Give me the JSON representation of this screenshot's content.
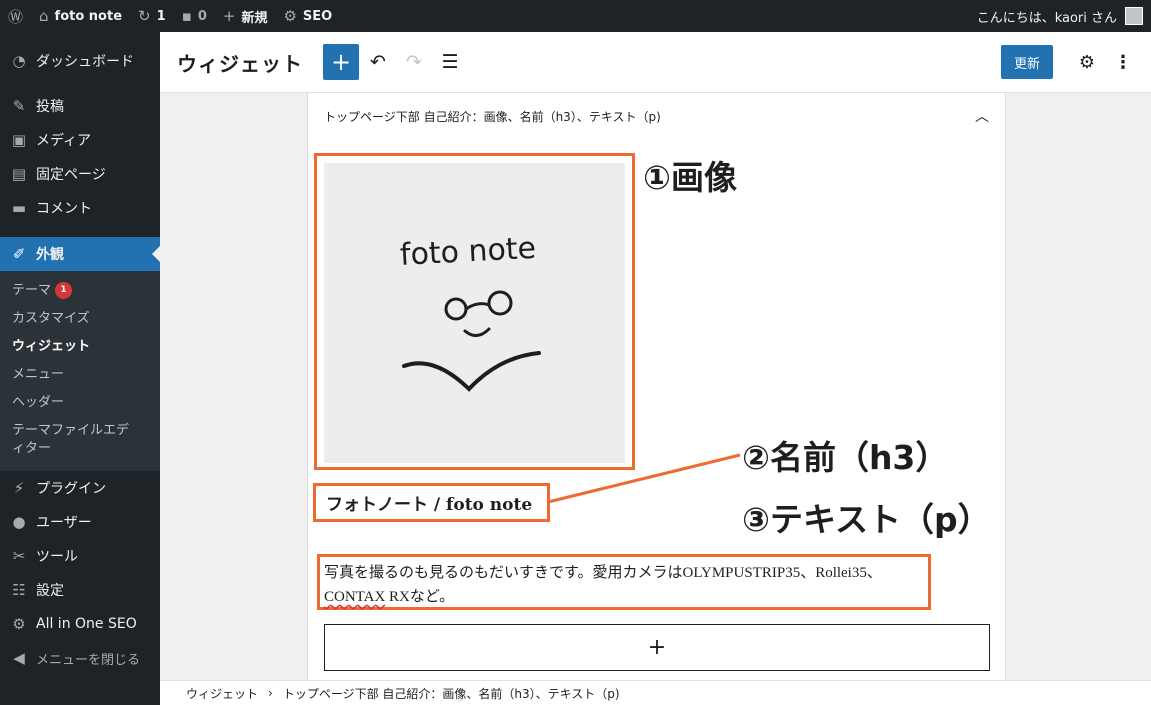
{
  "adminbar": {
    "site_name": "foto note",
    "updates_count": "1",
    "comments_count": "0",
    "new_label": "新規",
    "seo_label": "SEO",
    "greeting": "こんにちは、kaori さん"
  },
  "sidebar": {
    "items": [
      {
        "label": "ダッシュボード",
        "icon": "dashboard-icon"
      },
      {
        "label": "投稿",
        "icon": "pin-icon"
      },
      {
        "label": "メディア",
        "icon": "media-icon"
      },
      {
        "label": "固定ページ",
        "icon": "page-icon"
      },
      {
        "label": "コメント",
        "icon": "comment-icon"
      },
      {
        "label": "外観",
        "icon": "brush-icon"
      },
      {
        "label": "プラグイン",
        "icon": "plugin-icon"
      },
      {
        "label": "ユーザー",
        "icon": "user-icon"
      },
      {
        "label": "ツール",
        "icon": "wrench-icon"
      },
      {
        "label": "設定",
        "icon": "settings-icon"
      },
      {
        "label": "All in One SEO",
        "icon": "seo-icon"
      },
      {
        "label": "メニューを閉じる",
        "icon": "collapse-icon"
      }
    ],
    "submenu": [
      {
        "label": "テーマ",
        "badge": "1"
      },
      {
        "label": "カスタマイズ"
      },
      {
        "label": "ウィジェット"
      },
      {
        "label": "メニュー"
      },
      {
        "label": "ヘッダー"
      },
      {
        "label": "テーマファイルエディター"
      }
    ]
  },
  "header": {
    "title": "ウィジェット",
    "update_label": "更新"
  },
  "widget_area": {
    "title": "トップページ下部 自己紹介：画像、名前（h3）、テキスト（p)",
    "heading_text": "フォトノート / foto note",
    "paragraph_part1": "写真を撮るのも見るのもだいすきです。愛用カメラはOLYMPUSTRIP35、Rollei35、",
    "paragraph_spell": "CONTAX",
    "paragraph_part2": " RXなど。",
    "image_text": "foto note"
  },
  "annotations": {
    "image": "①画像",
    "name": "②名前（h3）",
    "text": "③テキスト（p）"
  },
  "breadcrumb": {
    "root": "ウィジェット",
    "separator": "›",
    "current": "トップページ下部 自己紹介：画像、名前（h3）、テキスト（p)"
  },
  "colors": {
    "admin_dark": "#1d2327",
    "accent": "#2271b1",
    "annotation_border": "#ef6a2f",
    "badge": "#d63638"
  }
}
